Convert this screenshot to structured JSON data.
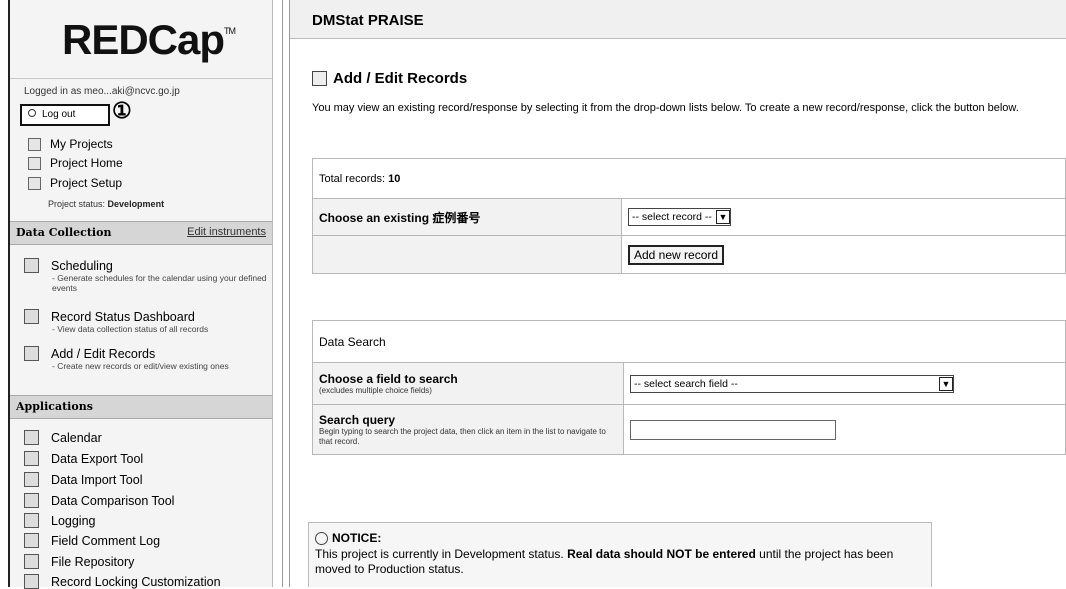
{
  "sidebar": {
    "logo": "REDCap",
    "logo_tm": "TM",
    "logged_in": "Logged in as meo...aki@ncvc.go.jp",
    "logout": "Log out",
    "annotation_number": "①",
    "nav": [
      {
        "label": "My Projects",
        "icon": "projects-icon"
      },
      {
        "label": "Project Home",
        "icon": "home-icon"
      },
      {
        "label": "Project Setup",
        "icon": "setup-icon"
      }
    ],
    "project_status_label": "Project status:",
    "project_status_value": "Development",
    "data_collection": {
      "title": "Data Collection",
      "edit_link": "Edit instruments",
      "items": [
        {
          "label": "Scheduling",
          "desc": "- Generate schedules for the calendar using your defined events"
        },
        {
          "label": "Record Status Dashboard",
          "desc": "- View data collection status of all records"
        },
        {
          "label": "Add / Edit Records",
          "desc": "- Create new records or edit/view existing ones"
        }
      ]
    },
    "applications": {
      "title": "Applications",
      "items": [
        "Calendar",
        "Data Export Tool",
        "Data Import Tool",
        "Data Comparison Tool",
        "Logging",
        "Field Comment Log",
        "File Repository",
        "Record Locking Customization"
      ]
    }
  },
  "main": {
    "project_title": "DMStat PRAISE",
    "page_title": "Add / Edit Records",
    "intro": "You may view an existing record/response by selecting it from the drop-down lists below. To create a new record/response, click the button below.",
    "records": {
      "total_label": "Total records:",
      "total_value": "10",
      "choose_label": "Choose an existing 症例番号",
      "select_value": "-- select record --",
      "add_button": "Add new record"
    },
    "search": {
      "title": "Data Search",
      "field_label": "Choose a field to search",
      "field_sub": "(excludes multiple choice fields)",
      "field_select": "-- select search field --",
      "query_label": "Search query",
      "query_sub": "Begin typing to search the project data, then click an item in the list to navigate to that record.",
      "query_value": ""
    },
    "notice": {
      "title": "NOTICE:",
      "text_a": "This project is currently in Development status. ",
      "text_b": "Real data should NOT be entered",
      "text_c": " until the project has been moved to Production status."
    }
  }
}
